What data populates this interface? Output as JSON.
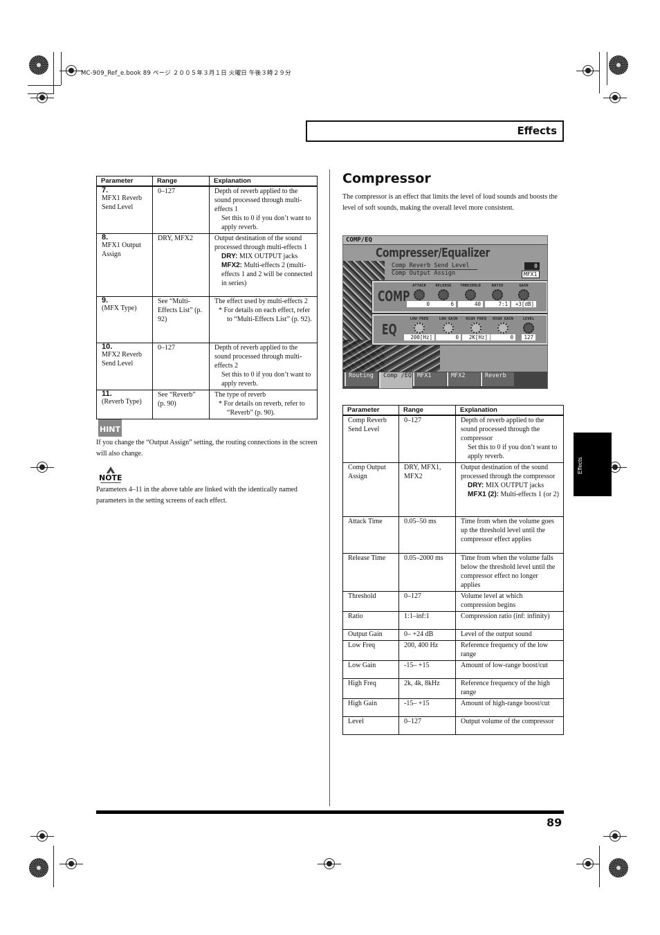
{
  "print_header": "MC-909_Ref_e.book  89 ページ  ２００５年３月１日  火曜日  午後３時２９分",
  "section_title": "Effects",
  "side_tab_label": "Effects",
  "page_number": "89",
  "table1": {
    "headers": [
      "Parameter",
      "Range",
      "Explanation"
    ],
    "rows": [
      {
        "num": "7.",
        "param": "MFX1 Reverb Send Level",
        "range": "0–127",
        "explanation": "Depth of reverb applied to the sound processed through multi-effects 1",
        "sub": "Set this to 0 if you don’t want to apply reverb."
      },
      {
        "num": "8.",
        "param": "MFX1 Output Assign",
        "range": "DRY, MFX2",
        "explanation": "Output destination of the sound processed through multi-effects 1",
        "opt1_label": "DRY:",
        "opt1_text": " MIX OUTPUT jacks",
        "opt2_label": "MFX2:",
        "opt2_text": " Multi-effects 2 (multi-effects 1 and 2 will be connected in series)"
      },
      {
        "num": "9.",
        "param": "(MFX Type)",
        "range": "See “Multi-Effects List” (p. 92)",
        "explanation": "The effect used by multi-effects 2",
        "note": "* For details on each effect, refer to “Multi-Effects List” (p. 92)."
      },
      {
        "num": "10.",
        "param": "MFX2 Reverb Send Level",
        "range": "0–127",
        "explanation": "Depth of reverb applied to the sound processed through multi-effects 2",
        "sub": "Set this to 0 if you don’t want to apply reverb."
      },
      {
        "num": "11.",
        "param": "(Reverb Type)",
        "range": "See “Reverb” (p. 90)",
        "explanation": "The type of reverb",
        "note": "* For details on reverb, refer to “Reverb” (p. 90)."
      }
    ]
  },
  "hint": {
    "icon_label": "HINT",
    "text": "If you change the “Output Assign” setting, the routing connections in the screen will also change."
  },
  "note": {
    "icon_label": "NOTE",
    "text": "Parameters 4–11 in the above table are linked with the identically named parameters in the setting screens of each effect."
  },
  "compressor": {
    "heading": "Compressor",
    "intro": "The compressor is an effect that limits the level of loud sounds and boosts the level of soft sounds, making the overall level more consistent."
  },
  "screen": {
    "top_label": "COMP/EQ",
    "title": "Compresser/Equalizer",
    "param1_label": "Comp Reverb Send Level",
    "param1_value": "0",
    "param2_label": "Comp Output Assign",
    "param2_value": "MFX1",
    "comp_label": "COMP",
    "eq_label": "EQ",
    "comp_knobs": [
      {
        "label": "ATTACK",
        "value": "0"
      },
      {
        "label": "RELEASE",
        "value": "6"
      },
      {
        "label": "THRESHOLD",
        "value": "40"
      },
      {
        "label": "RATIO",
        "value": "7:1"
      },
      {
        "label": "GAIN",
        "value": "+3[dB]"
      }
    ],
    "eq_knobs": [
      {
        "label": "LOW FREQ",
        "value": "200[Hz]"
      },
      {
        "label": "LOW GAIN",
        "value": "0"
      },
      {
        "label": "HIGH FREQ",
        "value": "2K[Hz]"
      },
      {
        "label": "HIGH GAIN",
        "value": "0"
      },
      {
        "label": "LEVEL",
        "value": "127"
      }
    ],
    "tabs": [
      "Routing",
      "Comp /EQ",
      "MFX1",
      "MFX2",
      "Reverb"
    ],
    "active_tab": "Comp /EQ"
  },
  "table2": {
    "headers": [
      "Parameter",
      "Range",
      "Explanation"
    ],
    "rows": [
      {
        "param": "Comp Reverb Send Level",
        "range": "0–127",
        "explanation": "Depth of reverb applied to the sound processed through the compressor",
        "sub": "Set this to 0 if you don’t want to apply reverb."
      },
      {
        "param": "Comp Output Assign",
        "range": "DRY, MFX1, MFX2",
        "explanation": "Output destination of the sound processed through the compressor",
        "opt1_label": "DRY:",
        "opt1_text": " MIX OUTPUT jacks",
        "opt2_label": "MFX1 (2):",
        "opt2_text": " Multi-effects 1 (or 2)"
      },
      {
        "param": "Attack Time",
        "range": "0.05–50 ms",
        "explanation": "Time from when the volume goes up the threshold level until the compressor effect applies"
      },
      {
        "param": "Release Time",
        "range": "0.05–2000 ms",
        "explanation": "Time from when the volume falls below the threshold level until the compressor effect no longer applies"
      },
      {
        "param": "Threshold",
        "range": "0–127",
        "explanation": "Volume level at which compression begins"
      },
      {
        "param": "Ratio",
        "range": "1:1–inf:1",
        "explanation": "Compression ratio (inf: infinity)"
      },
      {
        "param": "Output Gain",
        "range": "0– +24 dB",
        "explanation": "Level of the output sound"
      },
      {
        "param": "Low Freq",
        "range": "200, 400 Hz",
        "explanation": "Reference frequency of the low range"
      },
      {
        "param": "Low Gain",
        "range": "-15– +15",
        "explanation": "Amount of low-range boost/cut"
      },
      {
        "param": "High Freq",
        "range": "2k, 4k, 8kHz",
        "explanation": "Reference frequency of the high range"
      },
      {
        "param": "High Gain",
        "range": "-15– +15",
        "explanation": "Amount of high-range boost/cut"
      },
      {
        "param": "Level",
        "range": "0–127",
        "explanation": "Output volume of the compressor"
      }
    ]
  }
}
